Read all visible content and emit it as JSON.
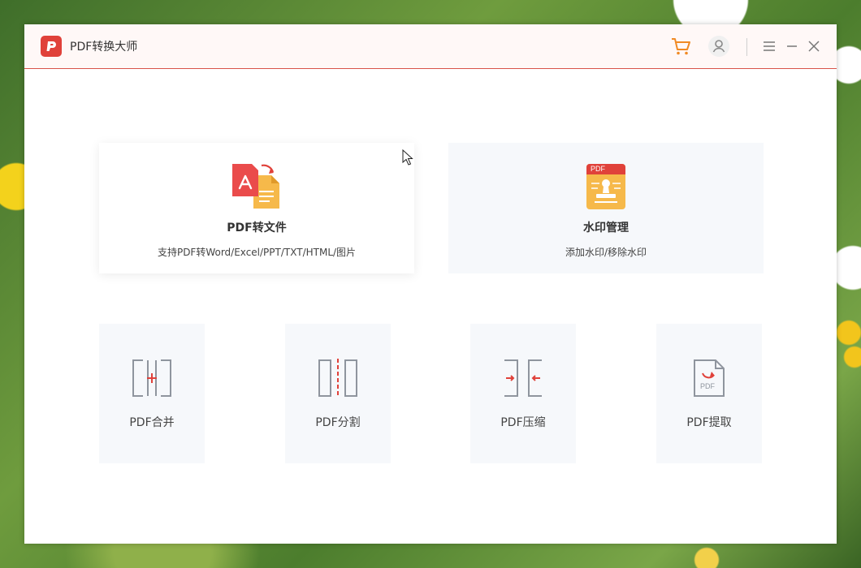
{
  "window": {
    "app_title": "PDF转换大师"
  },
  "toolbar": {
    "cart_icon": "cart-icon",
    "user_icon": "user-icon",
    "menu_icon": "menu-icon",
    "minimize_icon": "minimize-icon",
    "close_icon": "close-icon"
  },
  "features": {
    "convert": {
      "title": "PDF转文件",
      "desc": "支持PDF转Word/Excel/PPT/TXT/HTML/图片"
    },
    "watermark": {
      "title": "水印管理",
      "desc": "添加水印/移除水印",
      "badge": "PDF"
    }
  },
  "tools": [
    {
      "label": "PDF合并"
    },
    {
      "label": "PDF分割"
    },
    {
      "label": "PDF压缩"
    },
    {
      "label": "PDF提取",
      "badge": "PDF"
    }
  ],
  "colors": {
    "accent": "#e0413a",
    "card_bg": "#f6f8fb",
    "icon_gray": "#8f959e",
    "yellow": "#f6b94a"
  }
}
